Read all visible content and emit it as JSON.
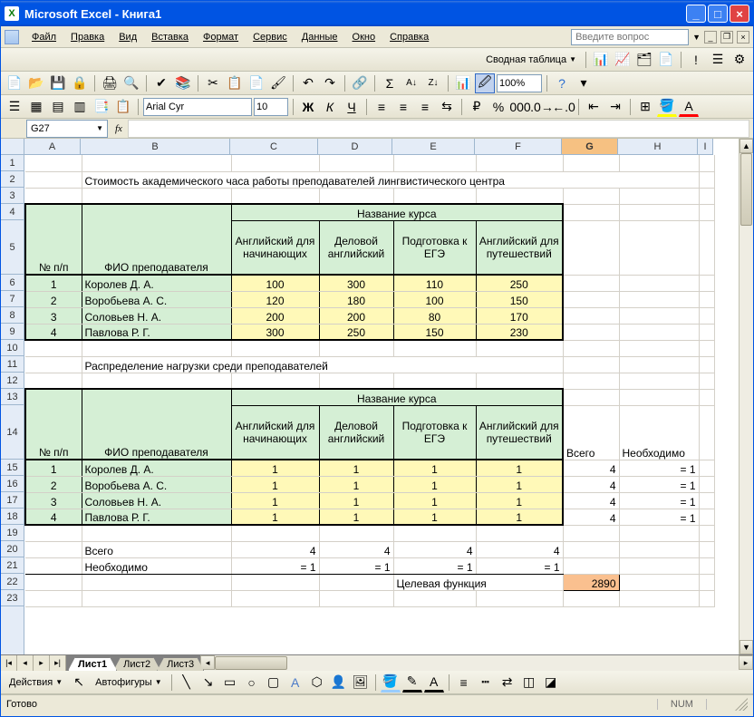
{
  "title": "Microsoft Excel - Книга1",
  "menus": [
    "Файл",
    "Правка",
    "Вид",
    "Вставка",
    "Формат",
    "Сервис",
    "Данные",
    "Окно",
    "Справка"
  ],
  "ask_placeholder": "Введите вопрос",
  "pivot_label": "Сводная таблица",
  "zoom": "100%",
  "font_name": "Arial Cyr",
  "font_size": "10",
  "namebox": "G27",
  "columns": [
    "A",
    "B",
    "C",
    "D",
    "E",
    "F",
    "G",
    "H",
    "I"
  ],
  "rows_visible": 23,
  "title1": "Стоимость академического часа работы преподавателей лингвистического центра",
  "hdr_course": "Название курса",
  "hdr_num": "№ п/п",
  "hdr_fio": "ФИО преподавателя",
  "courses": [
    "Английский для начинающих",
    "Деловой английский",
    "Подготовка к ЕГЭ",
    "Английский для путешествий"
  ],
  "cost_rows": [
    {
      "n": "1",
      "name": "Королев Д. А.",
      "v": [
        100,
        300,
        110,
        250
      ]
    },
    {
      "n": "2",
      "name": "Воробьева А. С.",
      "v": [
        120,
        180,
        100,
        150
      ]
    },
    {
      "n": "3",
      "name": "Соловьев Н. А.",
      "v": [
        200,
        200,
        80,
        170
      ]
    },
    {
      "n": "4",
      "name": "Павлова Р. Г.",
      "v": [
        300,
        250,
        150,
        230
      ]
    }
  ],
  "title2": "Распределение нагрузки среди преподавателей",
  "sum_label": "Всего",
  "req_label": "Необходимо",
  "assign_rows": [
    {
      "n": "1",
      "name": "Королев Д. А.",
      "v": [
        1,
        1,
        1,
        1
      ],
      "sum": 4,
      "req": "= 1"
    },
    {
      "n": "2",
      "name": "Воробьева А. С.",
      "v": [
        1,
        1,
        1,
        1
      ],
      "sum": 4,
      "req": "= 1"
    },
    {
      "n": "3",
      "name": "Соловьев Н. А.",
      "v": [
        1,
        1,
        1,
        1
      ],
      "sum": 4,
      "req": "= 1"
    },
    {
      "n": "4",
      "name": "Павлова Р. Г.",
      "v": [
        1,
        1,
        1,
        1
      ],
      "sum": 4,
      "req": "= 1"
    }
  ],
  "col_sums": [
    4,
    4,
    4,
    4
  ],
  "col_reqs": [
    "= 1",
    "= 1",
    "= 1",
    "= 1"
  ],
  "objective_label": "Целевая функция",
  "objective_value": "2890",
  "sheets": [
    "Лист1",
    "Лист2",
    "Лист3"
  ],
  "active_sheet": 0,
  "draw_actions": "Действия",
  "draw_autoshapes": "Автофигуры",
  "status": "Готово",
  "status_num": "NUM"
}
